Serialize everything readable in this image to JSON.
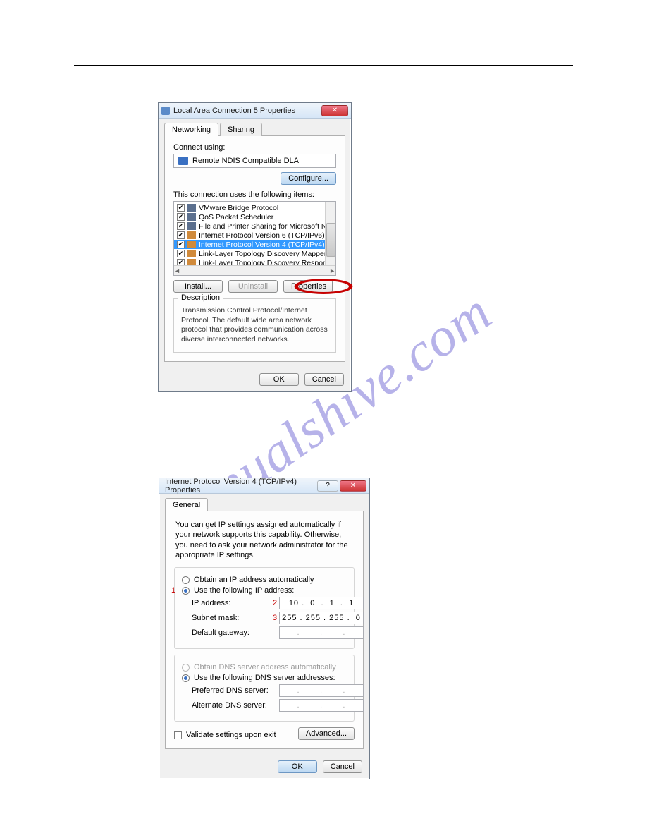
{
  "dialog1": {
    "title": "Local Area Connection 5 Properties",
    "tabs": {
      "networking": "Networking",
      "sharing": "Sharing"
    },
    "connect_using_label": "Connect using:",
    "adapter": "Remote NDIS Compatible DLA",
    "configure_button": "Configure...",
    "items_label": "This connection uses the following items:",
    "items": [
      "VMware Bridge Protocol",
      "QoS Packet Scheduler",
      "File and Printer Sharing for Microsoft Networks",
      "Internet Protocol Version 6 (TCP/IPv6)",
      "Internet Protocol Version 4 (TCP/IPv4)",
      "Link-Layer Topology Discovery Mapper I/O Driver",
      "Link-Layer Topology Discovery Responder"
    ],
    "install_button": "Install...",
    "uninstall_button": "Uninstall",
    "properties_button": "Properties",
    "description_title": "Description",
    "description_text": "Transmission Control Protocol/Internet Protocol. The default wide area network protocol that provides communication across diverse interconnected networks.",
    "ok_button": "OK",
    "cancel_button": "Cancel"
  },
  "dialog2": {
    "title": "Internet Protocol Version 4 (TCP/IPv4) Properties",
    "tab_general": "General",
    "help_text": "You can get IP settings assigned automatically if your network supports this capability. Otherwise, you need to ask your network administrator for the appropriate IP settings.",
    "radio_auto_ip": "Obtain an IP address automatically",
    "radio_use_ip": "Use the following IP address:",
    "ip_label": "IP address:",
    "ip_value": "10 .  0  .  1  .  1",
    "subnet_label": "Subnet mask:",
    "subnet_value": "255 . 255 . 255 .  0",
    "gateway_label": "Default gateway:",
    "gateway_value": ".       .       .",
    "radio_auto_dns": "Obtain DNS server address automatically",
    "radio_use_dns": "Use the following DNS server addresses:",
    "preferred_label": "Preferred DNS server:",
    "preferred_value": ".       .       .",
    "alternate_label": "Alternate DNS server:",
    "alternate_value": ".       .       .",
    "validate_label": "Validate settings upon exit",
    "advanced_button": "Advanced...",
    "ok_button": "OK",
    "cancel_button": "Cancel",
    "markers": {
      "m1": "1",
      "m2": "2",
      "m3": "3"
    }
  },
  "watermark": "manualshive.com"
}
